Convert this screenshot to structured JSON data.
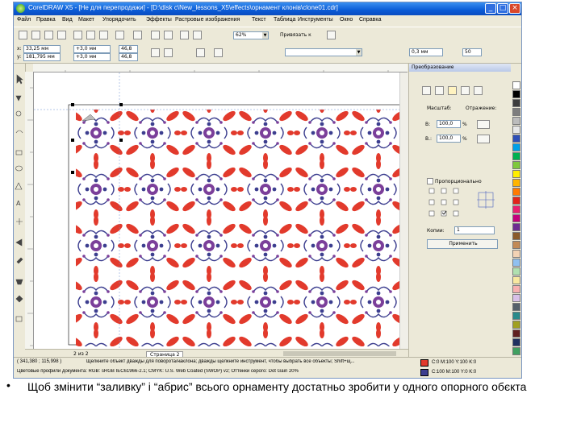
{
  "window": {
    "title": "CorelDRAW X5 - [Не для перепродажи] - [D:\\disk c\\New_lessons_X5\\effects\\орнамент клонів\\clone01.cdr]",
    "controls": [
      "_",
      "□",
      "×"
    ]
  },
  "menubar": {
    "items": [
      "Файл",
      "Правка",
      "Вид",
      "Макет",
      "Упорядочить",
      "Эффекты",
      "Растровые изображения",
      "Текст",
      "Таблица",
      "Инструменты",
      "Окно",
      "Справка"
    ]
  },
  "toolbar": {
    "zoom_value": "62%",
    "snap_label": "Привязать к",
    "outline_width": "0,3 мм"
  },
  "property_bar": {
    "x_label": "x:",
    "x_value": "33,25 мм",
    "y_label": "y:",
    "y_value": "181,795 мм",
    "nudge1": "+3,0 мм",
    "nudge2": "+3,0 мм",
    "size_w": "46,8",
    "size_h": "46,8",
    "scale_right": "50"
  },
  "docker": {
    "title": "Преобразование",
    "scale_label": "Масштаб:",
    "mirror_label": "Отражение:",
    "h_label": "В:",
    "h_value": "100,0",
    "v_label": "В.:",
    "v_value": "100,0",
    "percent": "%",
    "proportional_label": "Пропорционально",
    "copies_label": "Копии:",
    "copies_value": "1",
    "apply_button": "Применить"
  },
  "statusbar": {
    "page_nav": "2 из 2",
    "page_tab": "Страница 2",
    "coords": "( 341,380 ; 115,998 )",
    "hint": "Щелкните объект дважды для поворота/наклона; дважды щелкните инструмент, чтобы выбрать все объекты; Shift+щ...",
    "doc_profile": "Цветовые профили документа: RGB: sRGB IEC61966-2.1; CMYK: U.S. Web Coated (SWOP) v2; Оттенки серого: Dot Gain 20%",
    "fill_info": "C:0 M:100 Y:100 K:0",
    "outline_info": "C:100 M:100 Y:0 K:0"
  },
  "colors": {
    "ornament_red": "#e23a2c",
    "ornament_blue": "#3c3e8f",
    "ornament_purple": "#7b3f9a",
    "title_blue": "#0a5bd6"
  },
  "palette": [
    "#ffffff",
    "#000000",
    "#3c3c3c",
    "#7d7d7d",
    "#bcbcbc",
    "#e8e8e8",
    "#2e4fb8",
    "#00a0e8",
    "#00b050",
    "#7fc83c",
    "#ffef00",
    "#ffb400",
    "#ff7a00",
    "#e2231a",
    "#ea1f6f",
    "#c3007c",
    "#6d2c91",
    "#8a5a2a",
    "#c28a55",
    "#f2d2b4",
    "#90c0f0",
    "#b0e0b0",
    "#f8e8a0",
    "#f7b0b0",
    "#d8c0e8",
    "#55606a",
    "#2a8a8a",
    "#a0a020",
    "#602020",
    "#203060",
    "#40a060"
  ],
  "caption": {
    "bullet": "•",
    "text": "Щоб змінити “заливку” і “абрис” всього орнаменту достатньо зробити у одного опорного обєкта"
  }
}
